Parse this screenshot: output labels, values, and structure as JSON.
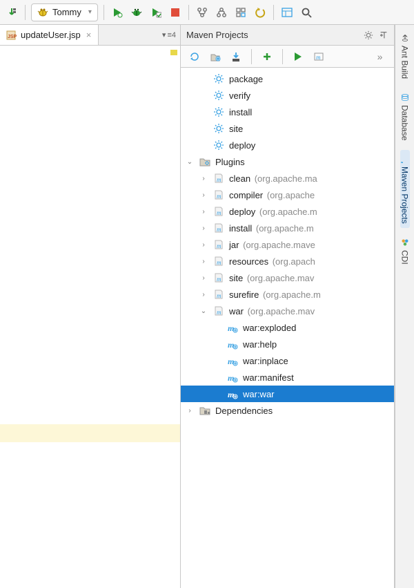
{
  "toolbar": {
    "run_config_label": "Tommy"
  },
  "editor": {
    "tabs": [
      {
        "label": "updateUser.jsp"
      }
    ],
    "tab_more_count": "≡4"
  },
  "panel": {
    "title": "Maven Projects",
    "tools_overflow": "»",
    "tree": {
      "lifecycle": [
        "package",
        "verify",
        "install",
        "site",
        "deploy"
      ],
      "plugins_label": "Plugins",
      "plugins": [
        {
          "name": "clean",
          "org": "(org.apache.ma"
        },
        {
          "name": "compiler",
          "org": "(org.apache"
        },
        {
          "name": "deploy",
          "org": "(org.apache.m"
        },
        {
          "name": "install",
          "org": "(org.apache.m"
        },
        {
          "name": "jar",
          "org": "(org.apache.mave"
        },
        {
          "name": "resources",
          "org": "(org.apach"
        },
        {
          "name": "site",
          "org": "(org.apache.mav"
        },
        {
          "name": "surefire",
          "org": "(org.apache.m"
        }
      ],
      "war_plugin": {
        "name": "war",
        "org": "(org.apache.mav"
      },
      "war_goals": [
        "war:exploded",
        "war:help",
        "war:inplace",
        "war:manifest",
        "war:war"
      ],
      "war_selected_index": 4,
      "dependencies_label": "Dependencies"
    }
  },
  "rightbar": {
    "items": [
      "Ant Build",
      "Database",
      "Maven Projects",
      "CDI"
    ],
    "active_index": 2
  }
}
